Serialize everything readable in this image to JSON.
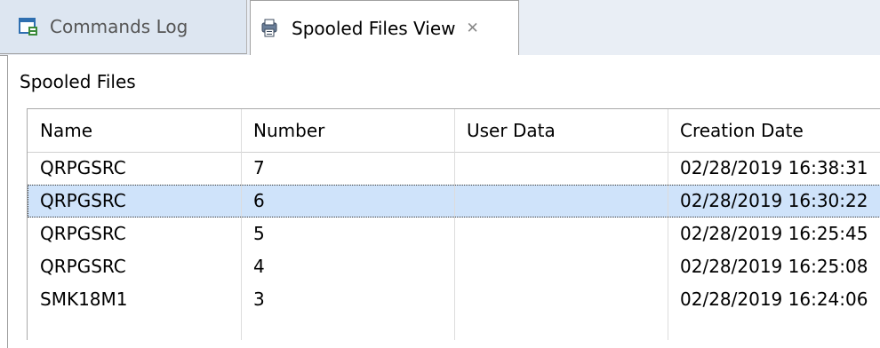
{
  "tabs": [
    {
      "label": "Commands Log",
      "icon": "commands-log-icon"
    },
    {
      "label": "Spooled Files View",
      "icon": "spooled-files-icon"
    }
  ],
  "section_title": "Spooled Files",
  "columns": [
    "Name",
    "Number",
    "User Data",
    "Creation Date"
  ],
  "rows": [
    {
      "name": "QRPGSRC",
      "number": "7",
      "user_data": "",
      "creation_date": "02/28/2019 16:38:31"
    },
    {
      "name": "QRPGSRC",
      "number": "6",
      "user_data": "",
      "creation_date": "02/28/2019 16:30:22"
    },
    {
      "name": "QRPGSRC",
      "number": "5",
      "user_data": "",
      "creation_date": "02/28/2019 16:25:45"
    },
    {
      "name": "QRPGSRC",
      "number": "4",
      "user_data": "",
      "creation_date": "02/28/2019 16:25:08"
    },
    {
      "name": "SMK18M1",
      "number": "3",
      "user_data": "",
      "creation_date": "02/28/2019 16:24:06"
    }
  ],
  "selected_row": 1,
  "colors": {
    "selection": "#cfe3fa",
    "tabbar": "#e9eef5"
  }
}
